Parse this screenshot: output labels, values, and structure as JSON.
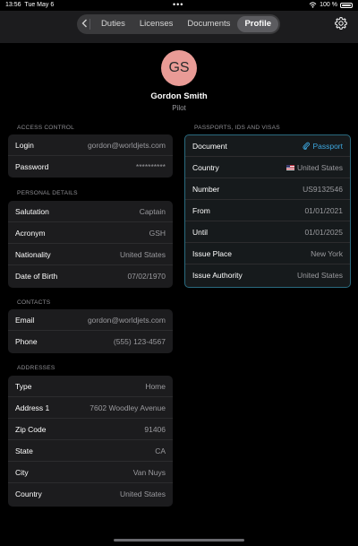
{
  "status": {
    "time": "13:56",
    "date": "Tue May 6",
    "dots": "•••",
    "battery": "100 %"
  },
  "nav": {
    "back_icon": "chevron-left-icon",
    "tabs": [
      {
        "label": "Duties",
        "active": false
      },
      {
        "label": "Licenses",
        "active": false
      },
      {
        "label": "Documents",
        "active": false
      },
      {
        "label": "Profile",
        "active": true
      }
    ],
    "settings_icon": "gear-icon"
  },
  "profile": {
    "initials": "GS",
    "name": "Gordon Smith",
    "role": "Pilot",
    "avatar_color": "#e99b96"
  },
  "access": {
    "title": "ACCESS CONTROL",
    "rows": [
      {
        "label": "Login",
        "value": "gordon@worldjets.com"
      },
      {
        "label": "Password",
        "value": "**********"
      }
    ]
  },
  "personal": {
    "title": "PERSONAL DETAILS",
    "rows": [
      {
        "label": "Salutation",
        "value": "Captain"
      },
      {
        "label": "Acronym",
        "value": "GSH"
      },
      {
        "label": "Nationality",
        "value": "United States"
      },
      {
        "label": "Date of Birth",
        "value": "07/02/1970"
      }
    ]
  },
  "contacts": {
    "title": "CONTACTS",
    "rows": [
      {
        "label": "Email",
        "value": "gordon@worldjets.com"
      },
      {
        "label": "Phone",
        "value": "(555) 123-4567"
      }
    ]
  },
  "addresses": {
    "title": "ADDRESSES",
    "rows": [
      {
        "label": "Type",
        "value": "Home"
      },
      {
        "label": "Address 1",
        "value": "7602 Woodley Avenue"
      },
      {
        "label": "Zip Code",
        "value": "91406"
      },
      {
        "label": "State",
        "value": "CA"
      },
      {
        "label": "City",
        "value": "Van Nuys"
      },
      {
        "label": "Country",
        "value": "United States"
      }
    ]
  },
  "passports": {
    "title": "PASSPORTS, IDS AND VISAS",
    "document": {
      "label": "Document",
      "value": "Passport",
      "icon": "paperclip-icon"
    },
    "country": {
      "label": "Country",
      "value": "United States",
      "icon": "us-flag-icon"
    },
    "rows": [
      {
        "label": "Number",
        "value": "US9132546"
      },
      {
        "label": "From",
        "value": "01/01/2021"
      },
      {
        "label": "Until",
        "value": "01/01/2025"
      },
      {
        "label": "Issue Place",
        "value": "New York"
      },
      {
        "label": "Issue Authority",
        "value": "United States"
      }
    ]
  },
  "colors": {
    "accent": "#3da8e0",
    "card": "#1c1c1e",
    "pass_border": "#2a6b80"
  }
}
